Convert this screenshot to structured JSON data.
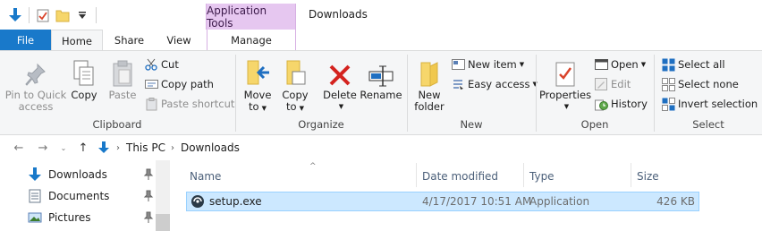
{
  "window": {
    "title": "Downloads",
    "context_tab": "Application Tools"
  },
  "ribbon_tabs": {
    "file": "File",
    "home": "Home",
    "share": "Share",
    "view": "View",
    "manage": "Manage"
  },
  "clipboard": {
    "pin_label_1": "Pin to Quick",
    "pin_label_2": "access",
    "copy": "Copy",
    "paste": "Paste",
    "cut": "Cut",
    "copy_path": "Copy path",
    "paste_shortcut": "Paste shortcut",
    "group": "Clipboard"
  },
  "organize": {
    "move_1": "Move",
    "move_2": "to",
    "copy_1": "Copy",
    "copy_2": "to",
    "delete": "Delete",
    "rename": "Rename",
    "group": "Organize"
  },
  "new": {
    "new_folder_1": "New",
    "new_folder_2": "folder",
    "new_item": "New item",
    "easy_access": "Easy access",
    "group": "New"
  },
  "open": {
    "properties": "Properties",
    "open": "Open",
    "edit": "Edit",
    "history": "History",
    "group": "Open"
  },
  "select": {
    "select_all": "Select all",
    "select_none": "Select none",
    "invert_selection": "Invert selection",
    "group": "Select"
  },
  "address": {
    "crumbs": [
      "This PC",
      "Downloads"
    ]
  },
  "nav_pane": {
    "items": [
      {
        "label": "Downloads"
      },
      {
        "label": "Documents"
      },
      {
        "label": "Pictures"
      }
    ]
  },
  "file_list": {
    "columns": [
      "Name",
      "Date modified",
      "Type",
      "Size"
    ],
    "rows": [
      {
        "name": "setup.exe",
        "date": "4/17/2017 10:51 AM",
        "type": "Application",
        "size": "426 KB"
      }
    ]
  },
  "colors": {
    "accent": "#1979ca",
    "context_tab": "#e6c7f0",
    "selection": "#cce8ff"
  }
}
